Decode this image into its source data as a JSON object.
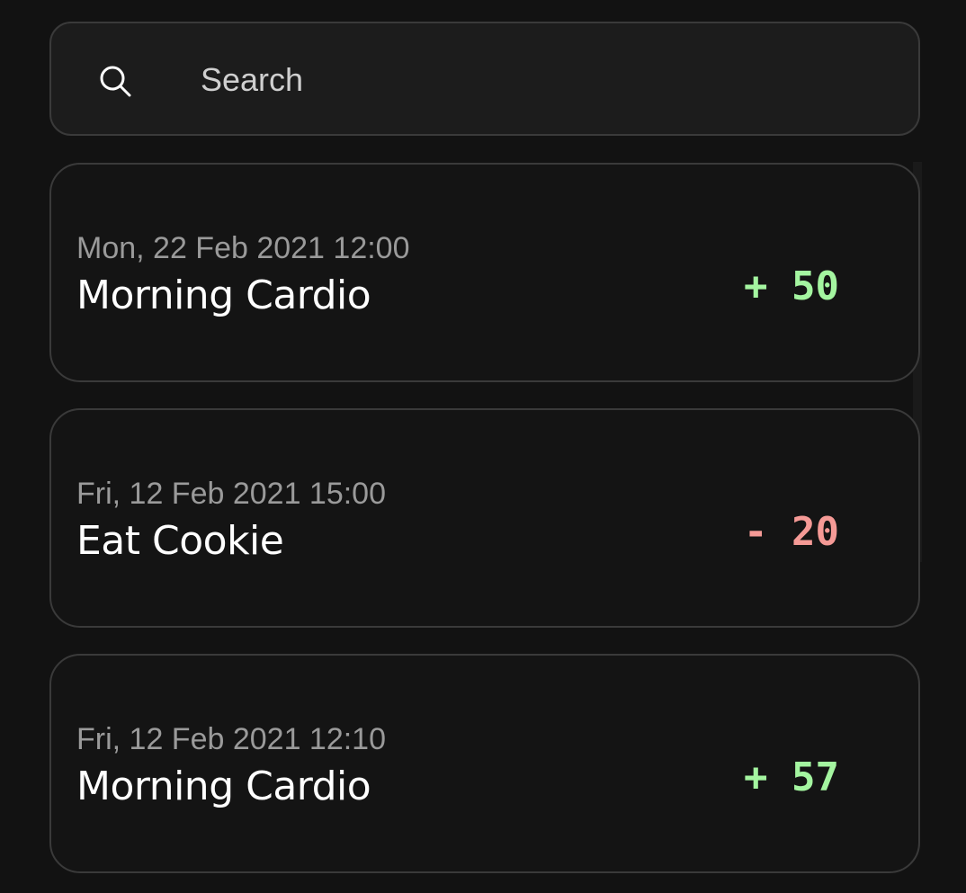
{
  "search": {
    "placeholder": "Search"
  },
  "colors": {
    "positive": "#a4f5a0",
    "negative": "#f59a96"
  },
  "entries": [
    {
      "date": "Mon, 22 Feb 2021 12:00",
      "title": "Morning Cardio",
      "points": "+ 50",
      "type": "positive"
    },
    {
      "date": "Fri, 12 Feb 2021 15:00",
      "title": "Eat Cookie",
      "points": "- 20",
      "type": "negative"
    },
    {
      "date": "Fri, 12 Feb 2021 12:10",
      "title": "Morning Cardio",
      "points": "+ 57",
      "type": "positive"
    }
  ]
}
